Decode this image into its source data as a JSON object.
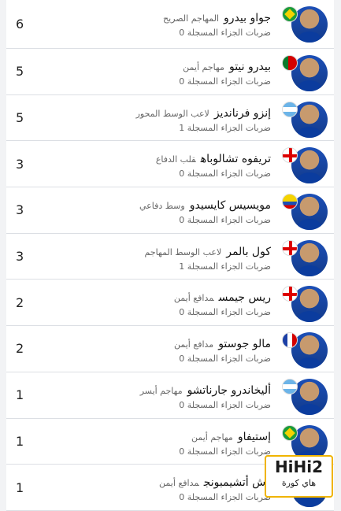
{
  "players": [
    {
      "count": "6",
      "name": "جواو بيدرو",
      "position": "المهاجم الصريح",
      "stat": "ضربات الجزاء المسجلة 0",
      "flag": "br"
    },
    {
      "count": "5",
      "name": "بيدرو نيتو",
      "position": "مهاجم أيمن",
      "stat": "ضربات الجزاء المسجلة 0",
      "flag": "pt"
    },
    {
      "count": "5",
      "name": "إنزو فرنانديز",
      "position": "لاعب الوسط المحور",
      "stat": "ضربات الجزاء المسجلة 1",
      "flag": "ar"
    },
    {
      "count": "3",
      "name": "تريفوه تشالوباه",
      "position": "قلب الدفاع",
      "stat": "ضربات الجزاء المسجلة 0",
      "flag": "en"
    },
    {
      "count": "3",
      "name": "مويسيس كايسيدو",
      "position": "وسط دفاعي",
      "stat": "ضربات الجزاء المسجلة 0",
      "flag": "ec"
    },
    {
      "count": "3",
      "name": "كول بالمر",
      "position": "لاعب الوسط المهاجم",
      "stat": "ضربات الجزاء المسجلة 1",
      "flag": "en"
    },
    {
      "count": "2",
      "name": "ريس جيمس",
      "position": "مدافع أيمن",
      "stat": "ضربات الجزاء المسجلة 0",
      "flag": "en"
    },
    {
      "count": "2",
      "name": "مالو جوستو",
      "position": "مدافع أيمن",
      "stat": "ضربات الجزاء المسجلة 0",
      "flag": "fr"
    },
    {
      "count": "1",
      "name": "أليخاندرو جارناتشو",
      "position": "مهاجم أيسر",
      "stat": "ضربات الجزاء المسجلة 0",
      "flag": "ar"
    },
    {
      "count": "1",
      "name": "إستيفاو",
      "position": "مهاجم أيمن",
      "stat": "ضربات الجزاء المسجلة 0",
      "flag": "br"
    },
    {
      "count": "1",
      "name": "وش أتشيمبونج",
      "position": "مدافع أيمن",
      "stat": "ضربات الجزاء المسجلة 0",
      "flag": ""
    }
  ],
  "logo": {
    "top": "HiHi2",
    "bottom": "هاي كورة"
  }
}
